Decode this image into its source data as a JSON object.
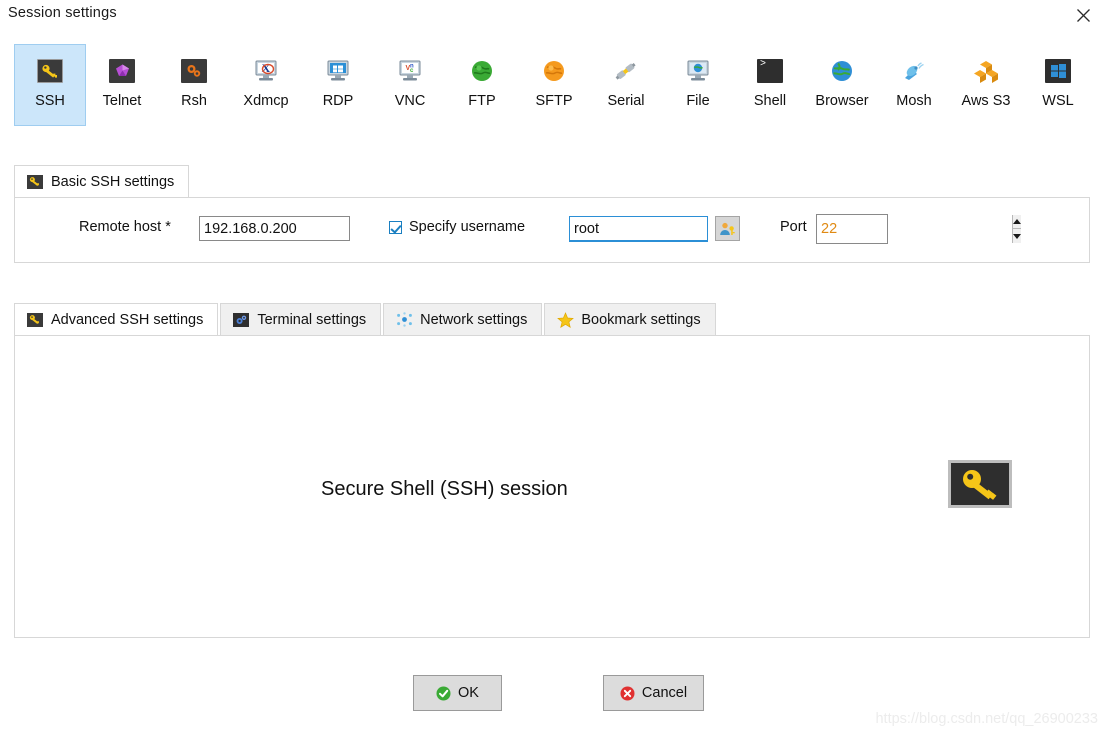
{
  "window": {
    "title": "Session settings",
    "close_label": "×"
  },
  "protocols": [
    {
      "label": "SSH",
      "icon": "ssh-key-icon"
    },
    {
      "label": "Telnet",
      "icon": "telnet-gem-icon"
    },
    {
      "label": "Rsh",
      "icon": "rsh-gears-icon"
    },
    {
      "label": "Xdmcp",
      "icon": "xdmcp-monitor-icon"
    },
    {
      "label": "RDP",
      "icon": "rdp-windows-monitor-icon"
    },
    {
      "label": "VNC",
      "icon": "vnc-monitor-icon"
    },
    {
      "label": "FTP",
      "icon": "ftp-green-globe-icon"
    },
    {
      "label": "SFTP",
      "icon": "sftp-orange-globe-icon"
    },
    {
      "label": "Serial",
      "icon": "serial-plug-icon"
    },
    {
      "label": "File",
      "icon": "file-monitor-globe-icon"
    },
    {
      "label": "Shell",
      "icon": "shell-terminal-icon"
    },
    {
      "label": "Browser",
      "icon": "browser-globe-icon"
    },
    {
      "label": "Mosh",
      "icon": "mosh-satellite-icon"
    },
    {
      "label": "Aws S3",
      "icon": "aws-s3-cubes-icon"
    },
    {
      "label": "WSL",
      "icon": "wsl-windows-icon"
    }
  ],
  "selected_protocol": "SSH",
  "basic_tab": {
    "label": "Basic SSH settings",
    "icon": "ssh-key-icon"
  },
  "form": {
    "remote_host_label": "Remote host *",
    "remote_host_value": "192.168.0.200",
    "remote_host_placeholder": "",
    "specify_username_label": "Specify username",
    "specify_username_checked": "true",
    "username_value": "root",
    "username_placeholder": "",
    "user_key_button_icon": "user-key-icon",
    "port_label": "Port",
    "port_value": "22"
  },
  "lower_tabs": [
    {
      "label": "Advanced SSH settings",
      "icon": "ssh-key-icon",
      "active": "true"
    },
    {
      "label": "Terminal settings",
      "icon": "terminal-gear-icon",
      "active": "false"
    },
    {
      "label": "Network settings",
      "icon": "network-nodes-icon",
      "active": "false"
    },
    {
      "label": "Bookmark settings",
      "icon": "star-icon",
      "active": "false"
    }
  ],
  "content": {
    "session_description": "Secure Shell (SSH) session",
    "badge_icon": "big-key-icon"
  },
  "footer": {
    "ok_label": "OK",
    "cancel_label": "Cancel",
    "ok_icon": "green-check-icon",
    "cancel_icon": "red-x-icon"
  },
  "watermark": "https://blog.csdn.net/qq_26900233",
  "colors": {
    "selection_blue": "#cce6fa",
    "selection_border": "#9fcdf0",
    "focus_blue": "#2b8fd6",
    "port_text": "#e08a13",
    "key_yellow": "#f5c518",
    "ok_green": "#3aaa35",
    "cancel_red": "#e03131",
    "panel_border": "#d7d7d7",
    "button_face": "#dcdcdc"
  }
}
